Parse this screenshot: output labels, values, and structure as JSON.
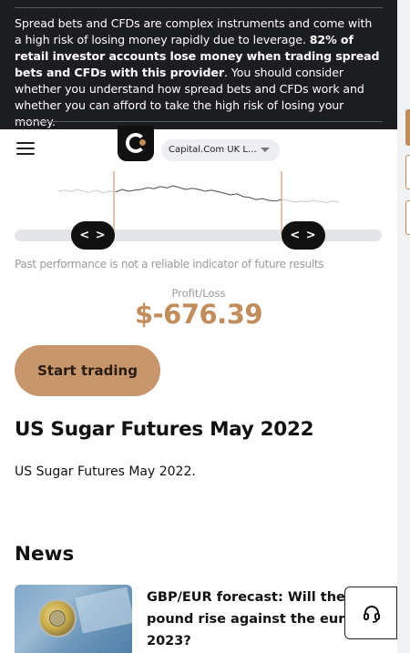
{
  "warning": {
    "text_1": "Spread bets and CFDs are complex instruments and come with a high risk of losing money rapidly due to leverage. ",
    "text_bold": "82% of retail investor accounts lose money when trading spread bets and CFDs with this provider",
    "text_2": ". You should consider whether you understand how spread bets and CFDs work and whether you can afford to take the high risk of losing your money."
  },
  "header": {
    "entity_select": "Capital.Com UK Lim..."
  },
  "chart": {
    "left_handle": "< >",
    "right_handle": "< >"
  },
  "disclaimer": "Past performance is not a reliable indicator of future results",
  "profit_loss": {
    "label": "Profit/Loss",
    "value": "$-676.39"
  },
  "cta": {
    "start_trading": "Start trading"
  },
  "instrument": {
    "title": "US Sugar Futures May 2022",
    "description": "US Sugar Futures May 2022."
  },
  "news": {
    "heading": "News",
    "items": [
      {
        "title": "GBP/EUR forecast: Will the pound rise against the euro in 2023?"
      }
    ]
  },
  "colors": {
    "accent": "#c28d5c",
    "button": "#c8966c",
    "banner": "#1c1d20"
  },
  "chart_data": {
    "type": "line",
    "series_shape": [
      0.55,
      0.52,
      0.56,
      0.5,
      0.55,
      0.58,
      0.52,
      0.6,
      0.55,
      0.57,
      0.5,
      0.55,
      0.52,
      0.5,
      0.45,
      0.48,
      0.42,
      0.46,
      0.4,
      0.45,
      0.5,
      0.47,
      0.5,
      0.55,
      0.52,
      0.56,
      0.6,
      0.65,
      0.62,
      0.7,
      0.72,
      0.78,
      0.75,
      0.8,
      0.82,
      0.78,
      0.8,
      0.85,
      0.82,
      0.84,
      0.8,
      0.83,
      0.86,
      0.82,
      0.85
    ],
    "selected_range": [
      0.15,
      0.72
    ]
  }
}
